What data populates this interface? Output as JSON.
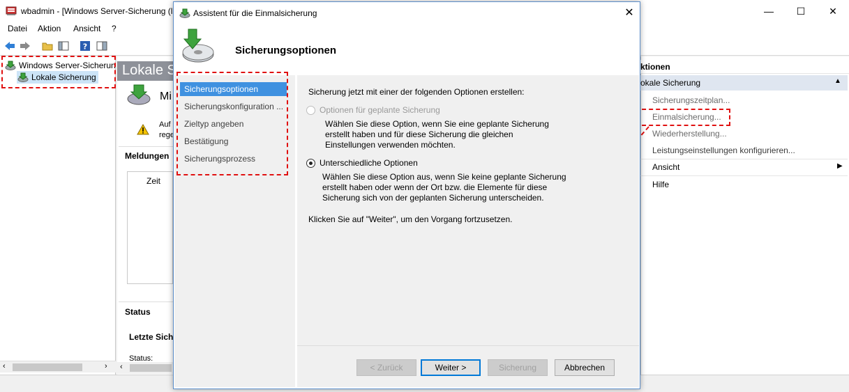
{
  "main_window": {
    "title": "wbadmin - [Windows Server-Sicherung (l",
    "menu": [
      "Datei",
      "Aktion",
      "Ansicht",
      "?"
    ],
    "controls": {
      "minimize": "—",
      "maximize": "☐",
      "close": "✕"
    }
  },
  "tree": {
    "root_label": "Windows Server-Sicherun",
    "child_label": "Lokale Sicherung"
  },
  "center": {
    "header": "Lokale Si",
    "mi_label": "Mi",
    "warning_line1": "Auf",
    "warning_line2": "rege",
    "messages_label": "Meldungen",
    "time_col": "Zeit",
    "status_label": "Status",
    "last_backup_label": "Letzte Sich",
    "status_field": "Status:"
  },
  "actions": {
    "header": "ktionen",
    "section": "okale Sicherung",
    "items": [
      "Sicherungszeitplan...",
      "Einmalsicherung...",
      "Wiederherstellung...",
      "Leistungseinstellungen konfigurieren...",
      "Ansicht",
      "Hilfe"
    ]
  },
  "dialog": {
    "title": "Assistent für die Einmalsicherung",
    "heading": "Sicherungsoptionen",
    "nav": [
      "Sicherungsoptionen",
      "Sicherungskonfiguration ...",
      "Zieltyp angeben",
      "Bestätigung",
      "Sicherungsprozess"
    ],
    "intro": "Sicherung jetzt mit einer der folgenden Optionen erstellen:",
    "option1_label": "Optionen für geplante Sicherung",
    "option1_desc": [
      "Wählen Sie diese Option, wenn Sie eine geplante Sicherung",
      "erstellt haben und für diese Sicherung die gleichen",
      "Einstellungen verwenden möchten."
    ],
    "option2_label": "Unterschiedliche Optionen",
    "option2_desc": [
      "Wählen Sie diese Option aus, wenn Sie keine geplante Sicherung",
      "erstellt haben oder wenn der Ort bzw. die Elemente für diese",
      "Sicherung sich von der geplanten Sicherung unterscheiden."
    ],
    "continue_hint": "Klicken Sie auf \"Weiter\", um den Vorgang fortzusetzen.",
    "buttons": {
      "back": "< Zurück",
      "next": "Weiter >",
      "backup": "Sicherung",
      "cancel": "Abbrechen"
    }
  },
  "colors": {
    "nav_active": "#3f91e0",
    "highlight_red": "#e01010",
    "header_gray": "#8e9199",
    "section_blue": "#dfe6f0"
  }
}
